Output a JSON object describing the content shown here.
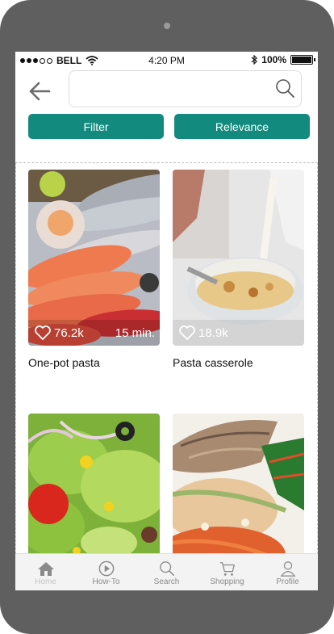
{
  "status": {
    "carrier": "BELL",
    "time": "4:20 PM",
    "battery": "100%"
  },
  "search": {
    "value": "",
    "placeholder": ""
  },
  "buttons": {
    "filter": "Filter",
    "relevance": "Relevance"
  },
  "recipes": [
    {
      "title": "One-pot pasta",
      "likes": "76.2k",
      "time": "15 min."
    },
    {
      "title": "Pasta casserole",
      "likes": "18.9k"
    },
    {
      "title": ""
    },
    {
      "title": ""
    }
  ],
  "tabs": [
    {
      "label": "Home",
      "icon": "home-icon"
    },
    {
      "label": "How-To",
      "icon": "play-icon"
    },
    {
      "label": "Search",
      "icon": "search-icon"
    },
    {
      "label": "Shopping",
      "icon": "cart-icon"
    },
    {
      "label": "Profile",
      "icon": "profile-icon"
    }
  ],
  "colors": {
    "accent": "#138a7e",
    "frame": "#5f5f5f",
    "tab_inactive": "#8a8a8a"
  }
}
